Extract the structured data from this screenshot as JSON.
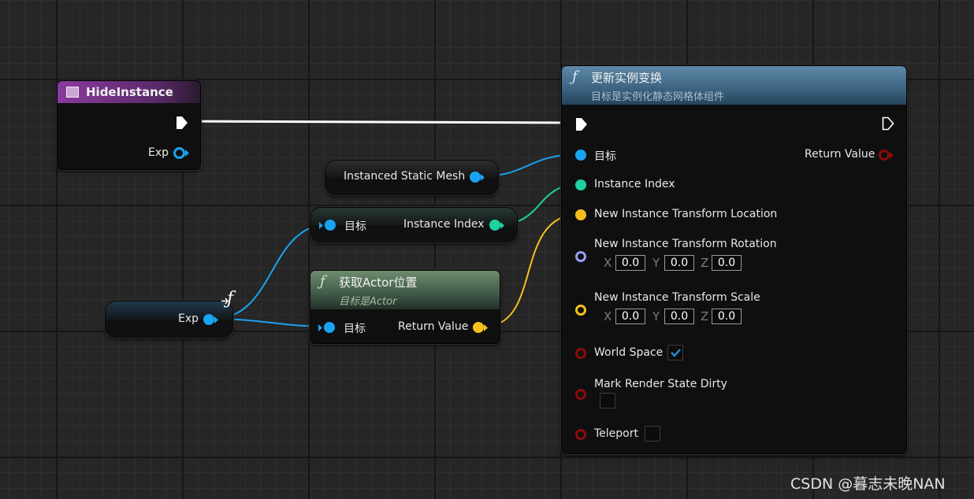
{
  "hide_instance_node": {
    "title": "HideInstance",
    "exp_label": "Exp"
  },
  "instanced_mesh_node": {
    "label": "Instanced Static Mesh"
  },
  "break_node": {
    "target_label": "目标",
    "index_label": "Instance Index"
  },
  "exp_node": {
    "label": "Exp"
  },
  "get_actor_location_node": {
    "title": "获取Actor位置",
    "subtitle": "目标是Actor",
    "target_label": "目标",
    "return_label": "Return Value"
  },
  "update_transform_node": {
    "title": "更新实例变换",
    "subtitle": "目标是实例化静态网格体组件",
    "target_label": "目标",
    "return_label": "Return Value",
    "index_label": "Instance Index",
    "location_label": "New Instance Transform Location",
    "rotation_label": "New Instance Transform Rotation",
    "rotation": {
      "x_axis": "X",
      "y_axis": "Y",
      "z_axis": "Z",
      "x": "0.0",
      "y": "0.0",
      "z": "0.0"
    },
    "scale_label": "New Instance Transform Scale",
    "scale": {
      "x_axis": "X",
      "y_axis": "Y",
      "z_axis": "Z",
      "x": "0.0",
      "y": "0.0",
      "z": "0.0"
    },
    "world_space_label": "World Space",
    "world_space_checked": true,
    "mark_dirty_label": "Mark Render State Dirty",
    "mark_dirty_checked": false,
    "teleport_label": "Teleport",
    "teleport_checked": false
  },
  "function_icon_glyph": "ƒ",
  "watermark": "CSDN @暮志未晚NAN",
  "colors": {
    "exec_wire": "#ffffff",
    "object_pin": "#1aa3f0",
    "int_pin": "#1fd1a0",
    "vector_pin": "#f5c01e",
    "rotator_pin": "#9a9cf7",
    "bool_pin": "#8a0b0b",
    "event_header": "#7a2e8a",
    "function_header": "#3d6d8c",
    "pure_header": "#5a7a5a"
  }
}
